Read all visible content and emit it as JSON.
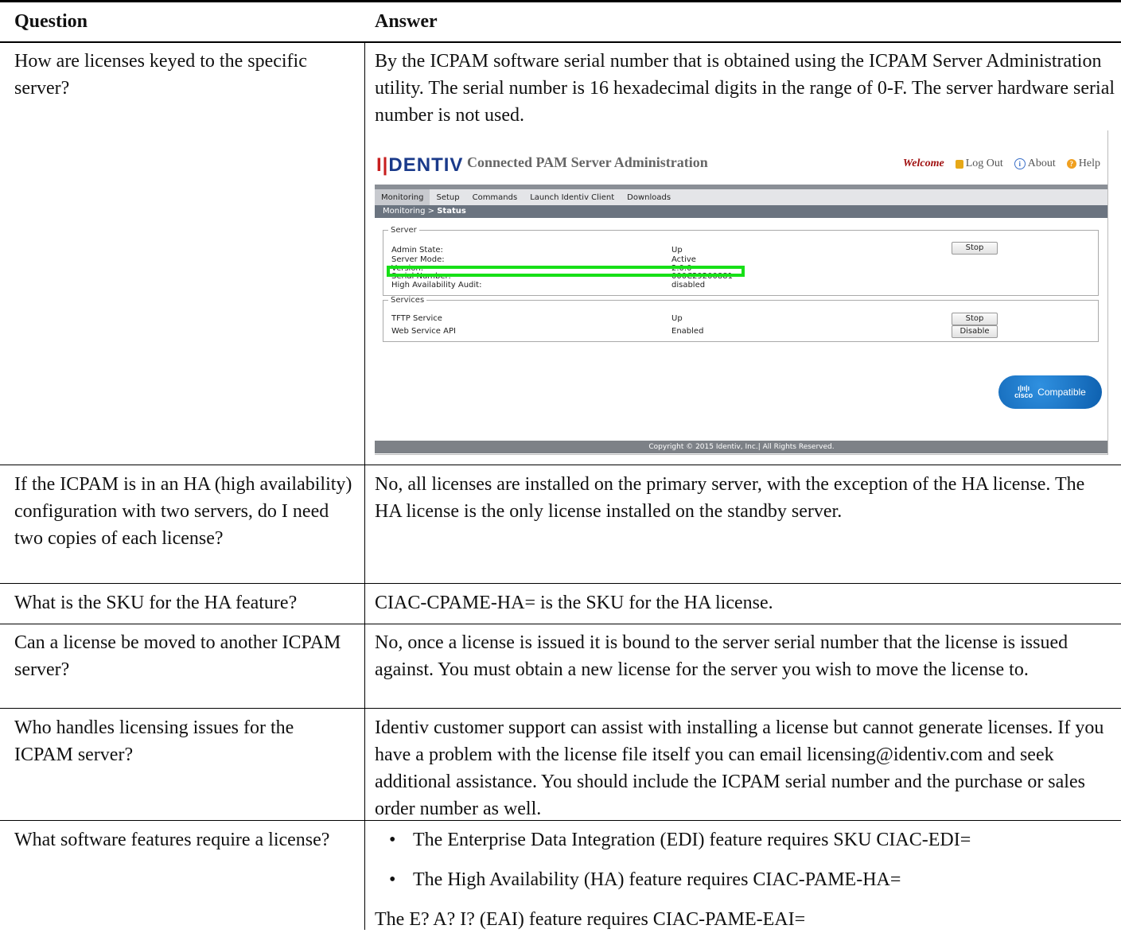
{
  "table": {
    "header_question": "Question",
    "header_answer": "Answer"
  },
  "rows": [
    {
      "question": "How are licenses keyed to the specific server?",
      "answer": "By the ICPAM software serial number that is obtained using the ICPAM Server Administration utility. The serial number is 16 hexadecimal digits in the range of 0-F. The server hardware serial number is not used."
    },
    {
      "question": "If the ICPAM is in an HA (high availability) configuration with two servers, do I need two copies of each license?",
      "answer": "No, all licenses are installed on the primary server, with the exception of the HA license. The HA license is the only license installed on the standby server."
    },
    {
      "question": "What is the SKU for the HA feature?",
      "answer": "CIAC-CPAME-HA= is the SKU for the HA license."
    },
    {
      "question": "Can a license be moved to another ICPAM server?",
      "answer": "No, once a license is issued it is bound to the server serial number that the license is issued against. You must obtain a new license for the server you wish to move the license to."
    },
    {
      "question": "Who handles licensing issues for the ICPAM server?",
      "answer": "Identiv customer support can assist with installing a license but cannot generate licenses. If you have a problem with the license file itself you can email licensing@identiv.com and seek additional assistance. You should include the ICPAM serial number and the purchase or sales order number as well."
    },
    {
      "question": "What software features require a license?",
      "bullets": [
        "The Enterprise Data Integration (EDI) feature requires SKU CIAC-EDI=",
        "The High Availability (HA) feature requires CIAC-PAME-HA="
      ],
      "answer_tail": "The E? A? I? (EAI) feature requires CIAC-PAME-EAI="
    }
  ],
  "screenshot": {
    "logo_bars": "I|",
    "logo_text": "DENTIV",
    "app_title": "Connected PAM Server Administration",
    "welcome": "Welcome",
    "logout": "Log Out",
    "about": "About",
    "help": "Help",
    "tabs": [
      "Monitoring",
      "Setup",
      "Commands",
      "Launch Identiv Client",
      "Downloads"
    ],
    "breadcrumb_parent": "Monitoring >",
    "breadcrumb_current": "Status",
    "server_legend": "Server",
    "server_rows": [
      {
        "label": "Admin State:",
        "value": "Up"
      },
      {
        "label": "Server Mode:",
        "value": "Active"
      },
      {
        "label": "Version:",
        "value": "2.0.0"
      },
      {
        "label": "Serial Number:",
        "value": "000C29200881"
      },
      {
        "label": "High Availability Audit:",
        "value": "disabled"
      }
    ],
    "server_stop": "Stop",
    "services_legend": "Services",
    "service_rows": [
      {
        "label": "TFTP Service",
        "value": "Up",
        "button": "Stop"
      },
      {
        "label": "Web Service API",
        "value": "Enabled",
        "button": "Disable"
      }
    ],
    "cisco_logo": "cisco",
    "cisco_badge": "Compatible",
    "copyright": "Copyright © 2015 Identiv, Inc.| All Rights Reserved."
  }
}
